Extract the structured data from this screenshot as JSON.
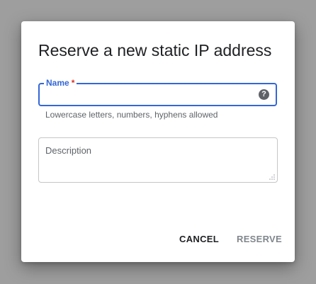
{
  "dialog": {
    "title": "Reserve a new static IP address",
    "name_field": {
      "label": "Name",
      "required_marker": "*",
      "value": "",
      "hint": "Lowercase letters, numbers, hyphens allowed",
      "help_icon": "help-circle-icon"
    },
    "description_field": {
      "placeholder": "Description",
      "value": ""
    },
    "actions": {
      "cancel_label": "CANCEL",
      "reserve_label": "RESERVE",
      "reserve_enabled": false
    }
  },
  "colors": {
    "accent": "#3367d6",
    "required": "#d93025",
    "text_primary": "#202124",
    "text_secondary": "#5f6368",
    "disabled": "#80868b",
    "scrim": "#9e9e9e"
  }
}
